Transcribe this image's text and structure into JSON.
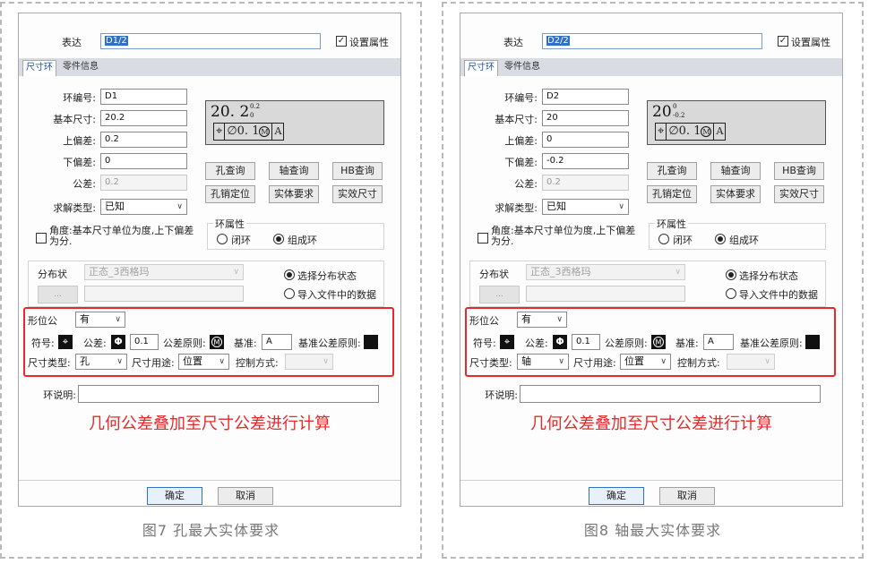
{
  "panels": [
    {
      "express_label": "表达",
      "express_value": "D1/2",
      "set_attr_label": "设置属性",
      "tabs": [
        "尺寸环",
        "零件信息"
      ],
      "ring_no_label": "环编号:",
      "ring_no": "D1",
      "basic_size_label": "基本尺寸:",
      "basic_size": "20.2",
      "upper_dev_label": "上偏差:",
      "upper_dev": "0.2",
      "lower_dev_label": "下偏差:",
      "lower_dev": "0",
      "tolerance_label": "公差:",
      "tolerance": "0.2",
      "solve_type_label": "求解类型:",
      "solve_type": "已知",
      "preview_main": "20. 2",
      "preview_sup": "0.2",
      "preview_sub": "0",
      "fcf_symbol": "⌖",
      "fcf_value": "∅0. 1",
      "fcf_modifier": "M",
      "fcf_datum": "A",
      "btn_hole_query": "孔查询",
      "btn_shaft_query": "轴查询",
      "btn_hb_query": "HB查询",
      "btn_pin_locate": "孔销定位",
      "btn_entity_req": "实体要求",
      "btn_eff_size": "实效尺寸",
      "angle_note": "角度:基本尺寸单位为度,上下偏差为分.",
      "ring_prop_title": "环属性",
      "radio_closed": "闭环",
      "radio_component": "组成环",
      "distribution_label": "分布状",
      "distribution_value": "正态_3西格玛",
      "ellipsis_btn": "...",
      "radio_select_dist": "选择分布状态",
      "radio_import_file": "导入文件中的数据",
      "gdt_label": "形位公",
      "gdt_value": "有",
      "symbol_label": "符号:",
      "tol_label2": "公差:",
      "tol_symbol": "Φ",
      "tol_value2": "0.1",
      "tol_principle_label": "公差原则:",
      "tol_principle_symbol": "M",
      "datum_label": "基准:",
      "datum_value": "A",
      "datum_principle_label": "基准公差原则:",
      "size_type_label": "尺寸类型:",
      "size_type": "孔",
      "size_use_label": "尺寸用途:",
      "size_use": "位置",
      "control_label": "控制方式:",
      "ring_desc_label": "环说明:",
      "annotation": "几何公差叠加至尺寸公差进行计算",
      "ok_btn": "确定",
      "cancel_btn": "取消",
      "caption": "图7  孔最大实体要求"
    },
    {
      "express_label": "表达",
      "express_value": "D2/2",
      "set_attr_label": "设置属性",
      "tabs": [
        "尺寸环",
        "零件信息"
      ],
      "ring_no_label": "环编号:",
      "ring_no": "D2",
      "basic_size_label": "基本尺寸:",
      "basic_size": "20",
      "upper_dev_label": "上偏差:",
      "upper_dev": "0",
      "lower_dev_label": "下偏差:",
      "lower_dev": "-0.2",
      "tolerance_label": "公差:",
      "tolerance": "0.2",
      "solve_type_label": "求解类型:",
      "solve_type": "已知",
      "preview_main": "20",
      "preview_sup": "0",
      "preview_sub": "-0.2",
      "fcf_symbol": "⌖",
      "fcf_value": "∅0. 1",
      "fcf_modifier": "M",
      "fcf_datum": "A",
      "btn_hole_query": "孔查询",
      "btn_shaft_query": "轴查询",
      "btn_hb_query": "HB查询",
      "btn_pin_locate": "孔销定位",
      "btn_entity_req": "实体要求",
      "btn_eff_size": "实效尺寸",
      "angle_note": "角度:基本尺寸单位为度,上下偏差为分.",
      "ring_prop_title": "环属性",
      "radio_closed": "闭环",
      "radio_component": "组成环",
      "distribution_label": "分布状",
      "distribution_value": "正态_3西格玛",
      "ellipsis_btn": "...",
      "radio_select_dist": "选择分布状态",
      "radio_import_file": "导入文件中的数据",
      "gdt_label": "形位公",
      "gdt_value": "有",
      "symbol_label": "符号:",
      "tol_label2": "公差:",
      "tol_symbol": "Φ",
      "tol_value2": "0.1",
      "tol_principle_label": "公差原则:",
      "tol_principle_symbol": "M",
      "datum_label": "基准:",
      "datum_value": "A",
      "datum_principle_label": "基准公差原则:",
      "size_type_label": "尺寸类型:",
      "size_type": "轴",
      "size_use_label": "尺寸用途:",
      "size_use": "位置",
      "control_label": "控制方式:",
      "ring_desc_label": "环说明:",
      "annotation": "几何公差叠加至尺寸公差进行计算",
      "ok_btn": "确定",
      "cancel_btn": "取消",
      "caption": "图8  轴最大实体要求"
    }
  ],
  "colors": {
    "annotation_red": "#e8292b",
    "accent_blue": "#2e73c9",
    "tab_bar": "#d9dde3"
  }
}
